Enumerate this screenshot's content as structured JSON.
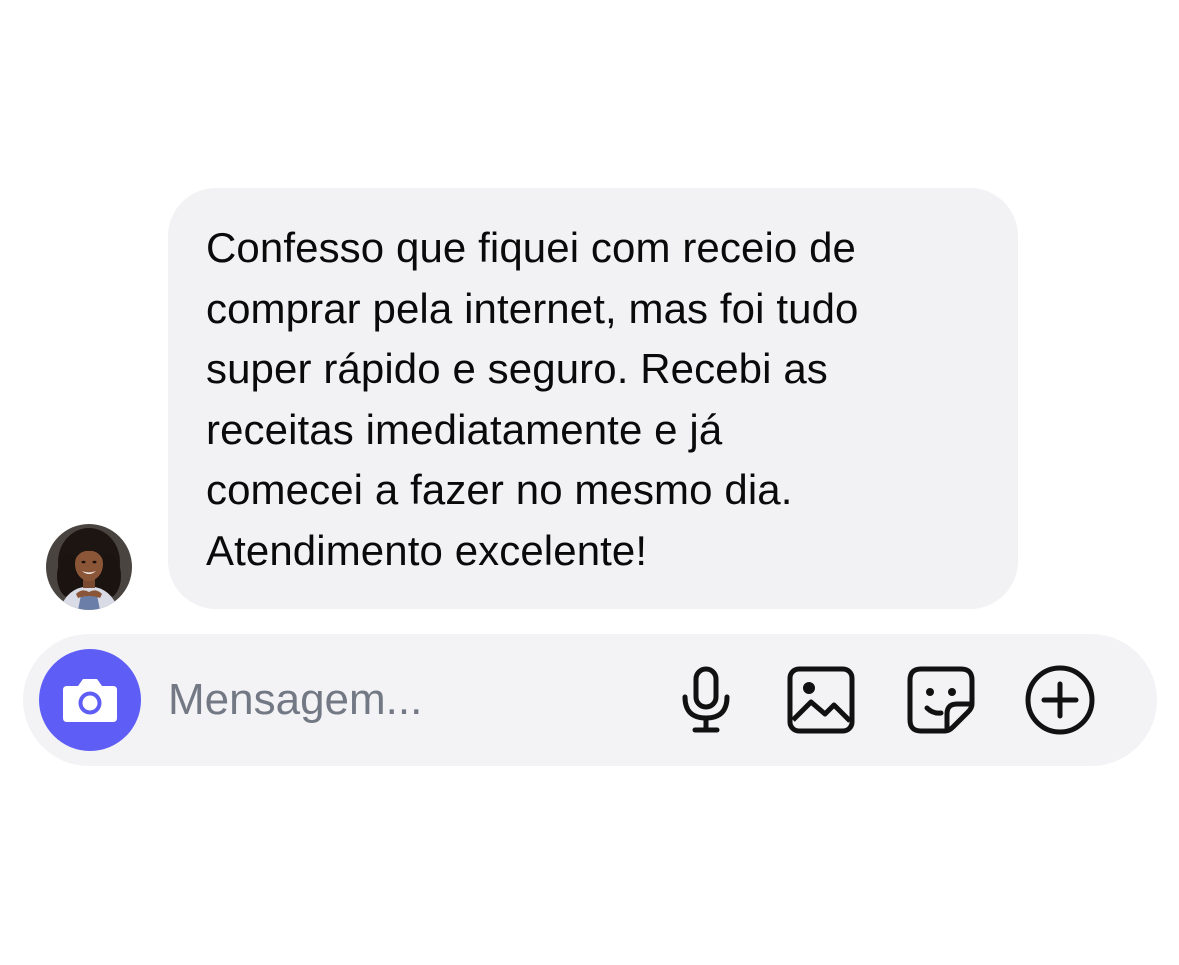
{
  "message": {
    "text": "Confesso que fiquei com receio de\ncomprar pela internet, mas foi tudo\nsuper rápido e seguro. Recebi as\nreceitas imediatamente e já\ncomecei a fazer no mesmo dia.\nAtendimento excelente!"
  },
  "composer": {
    "placeholder": "Mensagem...",
    "value": "",
    "icons": {
      "camera": "camera-icon",
      "microphone": "microphone-icon",
      "gallery": "image-icon",
      "sticker": "sticker-icon",
      "more": "plus-circle-icon"
    }
  },
  "colors": {
    "bubble_background": "#f2f2f5",
    "composer_background": "#f3f3f6",
    "accent": "#5e5ef6",
    "placeholder": "#737984",
    "text": "#0a0a0a"
  }
}
